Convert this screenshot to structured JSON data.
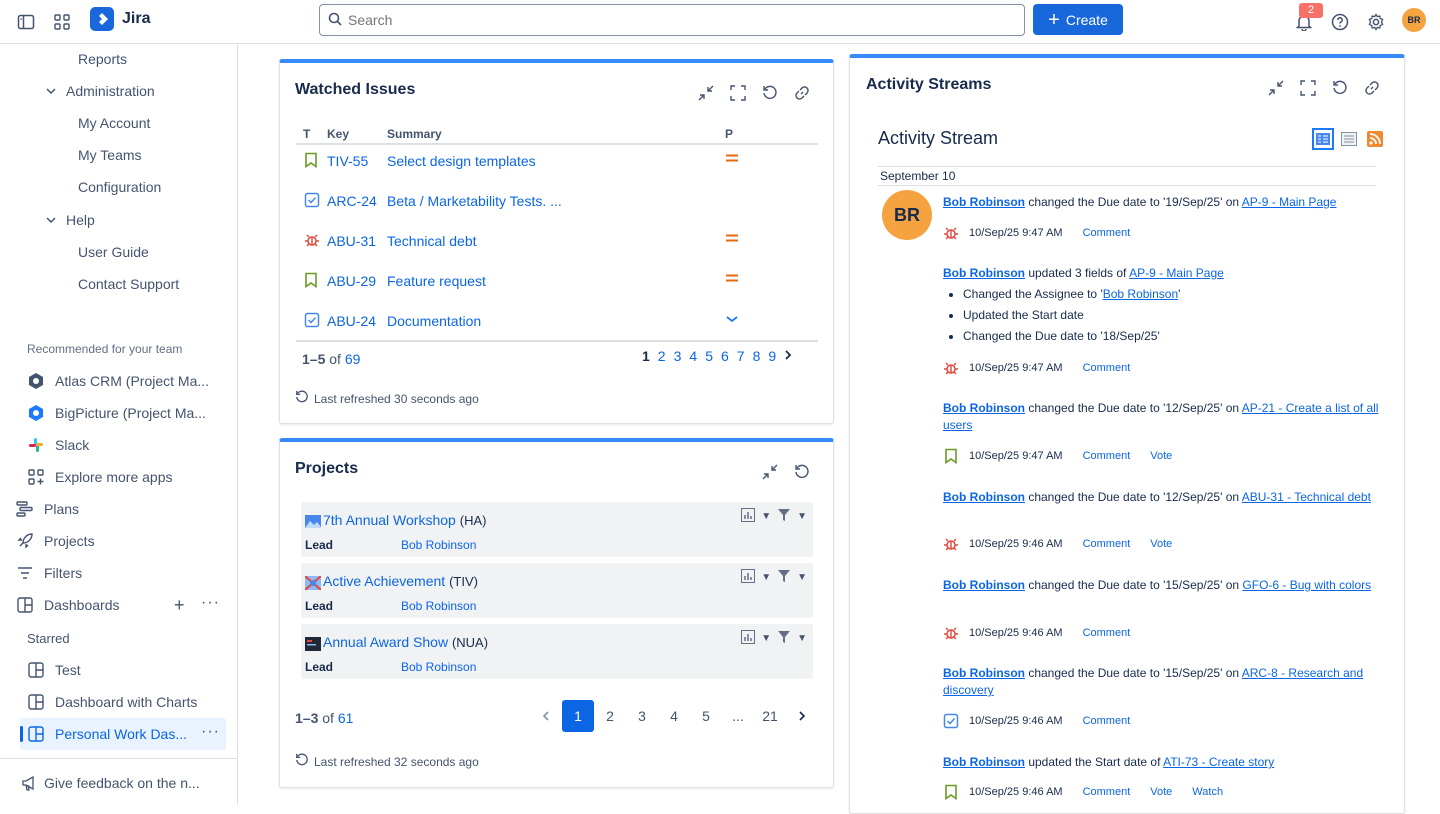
{
  "topbar": {
    "app_name": "Jira",
    "search_placeholder": "Search",
    "create_label": "Create",
    "notification_count": "2",
    "avatar_initials": "BR"
  },
  "sidebar": {
    "items_top": [
      "Reports",
      "Administration",
      "My Account",
      "My Teams",
      "Configuration",
      "Help",
      "User Guide",
      "Contact Support"
    ],
    "recommended_header": "Recommended for your team",
    "apps": [
      "Atlas CRM (Project Ma...",
      "BigPicture (Project Ma...",
      "Slack",
      "Explore more apps"
    ],
    "nav": [
      "Plans",
      "Projects",
      "Filters",
      "Dashboards"
    ],
    "starred_header": "Starred",
    "starred": [
      "Test",
      "Dashboard with Charts",
      "Personal Work Das..."
    ],
    "feedback": "Give feedback on the n..."
  },
  "watched": {
    "title": "Watched Issues",
    "columns": [
      "T",
      "Key",
      "Summary",
      "P"
    ],
    "rows": [
      {
        "type": "story",
        "key": "TIV-55",
        "summary": "Select design templates",
        "priority": "medium"
      },
      {
        "type": "task",
        "key": "ARC-24",
        "summary": "Beta / Marketability Tests. ...",
        "priority": "none"
      },
      {
        "type": "bug",
        "key": "ABU-31",
        "summary": "Technical debt",
        "priority": "medium"
      },
      {
        "type": "story",
        "key": "ABU-29",
        "summary": "Feature request",
        "priority": "medium"
      },
      {
        "type": "task",
        "key": "ABU-24",
        "summary": "Documentation",
        "priority": "low"
      }
    ],
    "range": "1–5",
    "of": "of",
    "total": "69",
    "pages": [
      "1",
      "2",
      "3",
      "4",
      "5",
      "6",
      "7",
      "8",
      "9"
    ],
    "refreshed": "Last refreshed 30 seconds ago"
  },
  "projects": {
    "title": "Projects",
    "items": [
      {
        "name": "7th Annual Workshop",
        "key": "(HA)",
        "lead_label": "Lead",
        "lead": "Bob Robinson"
      },
      {
        "name": "Active Achievement",
        "key": "(TIV)",
        "lead_label": "Lead",
        "lead": "Bob Robinson"
      },
      {
        "name": "Annual Award Show",
        "key": "(NUA)",
        "lead_label": "Lead",
        "lead": "Bob Robinson"
      }
    ],
    "range": "1–3",
    "of": "of",
    "total": "61",
    "pages": [
      "1",
      "2",
      "3",
      "4",
      "5",
      "...",
      "21"
    ],
    "refreshed": "Last refreshed 32 seconds ago"
  },
  "activity": {
    "gadget_title": "Activity Streams",
    "stream_title": "Activity Stream",
    "date": "September 10",
    "avatar": "BR",
    "user": "Bob Robinson",
    "entries": [
      {
        "text": " changed the Due date to '19/Sep/25' on ",
        "link": "AP-9 - Main Page",
        "time": "10/Sep/25 9:47 AM",
        "icon": "bug",
        "actions": [
          "Comment"
        ]
      },
      {
        "text": " updated 3 fields of ",
        "link": "AP-9 - Main Page",
        "time": "10/Sep/25 9:47 AM",
        "icon": "bug",
        "actions": [
          "Comment"
        ],
        "list_pre": "Changed the Assignee to '",
        "list_link": "Bob Robinson",
        "list_post": "'",
        "list2": "Updated the Start date",
        "list3": "Changed the Due date to '18/Sep/25'"
      },
      {
        "text": " changed the Due date to '12/Sep/25' on ",
        "link": "AP-21 - Create a list of all users",
        "time": "10/Sep/25 9:47 AM",
        "icon": "story",
        "actions": [
          "Comment",
          "Vote"
        ]
      },
      {
        "text": " changed the Due date to '12/Sep/25' on ",
        "link": "ABU-31 - Technical debt",
        "time": "10/Sep/25 9:46 AM",
        "icon": "bug",
        "actions": [
          "Comment",
          "Vote"
        ]
      },
      {
        "text": " changed the Due date to '15/Sep/25' on ",
        "link": "GFO-6 - Bug with colors",
        "time": "10/Sep/25 9:46 AM",
        "icon": "bug",
        "actions": [
          "Comment"
        ]
      },
      {
        "text": " changed the Due date to '15/Sep/25' on ",
        "link": "ARC-8 - Research and discovery",
        "time": "10/Sep/25 9:46 AM",
        "icon": "task",
        "actions": [
          "Comment"
        ]
      },
      {
        "text": " updated the Start date of ",
        "link": "ATI-73 - Create story",
        "time": "10/Sep/25 9:46 AM",
        "icon": "story",
        "actions": [
          "Comment",
          "Vote",
          "Watch"
        ]
      }
    ]
  },
  "colors": {
    "accent": "#1868db",
    "bug": "#e2483d",
    "story": "#6a9a23",
    "task": "#4688ec",
    "priority_medium": "#e56910"
  }
}
